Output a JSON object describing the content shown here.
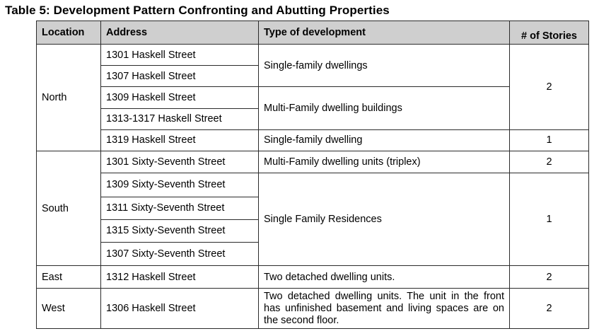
{
  "title": "Table 5:  Development Pattern Confronting and Abutting Properties",
  "headers": {
    "location": "Location",
    "address": "Address",
    "type": "Type of development",
    "stories": "# of Stories"
  },
  "rows": {
    "north": {
      "location": "North",
      "addresses": [
        "1301 Haskell Street",
        "1307 Haskell Street",
        "1309 Haskell Street",
        "1313-1317 Haskell Street",
        "1319 Haskell Street"
      ],
      "types": [
        "Single-family dwellings",
        "Multi-Family dwelling buildings",
        "Single-family dwelling"
      ],
      "stories": [
        "2",
        "1"
      ]
    },
    "south": {
      "location": "South",
      "addresses": [
        "1301 Sixty-Seventh Street",
        "1309 Sixty-Seventh Street",
        "1311 Sixty-Seventh Street",
        "1315 Sixty-Seventh Street",
        "1307 Sixty-Seventh Street"
      ],
      "types": [
        "Multi-Family dwelling units (triplex)",
        "Single Family Residences"
      ],
      "stories": [
        "2",
        "1"
      ]
    },
    "east": {
      "location": "East",
      "address": "1312 Haskell Street",
      "type": "Two detached dwelling units.",
      "stories": "2"
    },
    "west": {
      "location": "West",
      "address": "1306 Haskell Street",
      "type": "Two detached dwelling units. The unit in the front has unfinished basement and living spaces are on the second floor.",
      "stories": "2"
    }
  }
}
